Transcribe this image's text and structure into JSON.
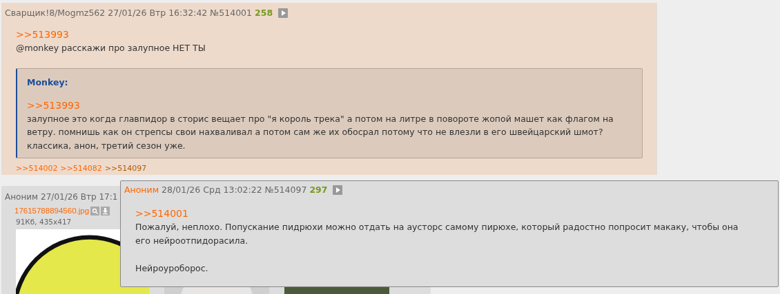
{
  "thread": {
    "post": {
      "author": "Сварщик!8/Mogmz562",
      "date": "27/01/26 Втр 16:32:42",
      "number": "№514001",
      "count": "258",
      "reply_link": ">>513993",
      "text": "@monkey расскажи про залупное НЕТ ТЫ",
      "quote": {
        "author": "Monkey:",
        "reply_link": ">>513993",
        "text": "залупное это когда главпидор в сторис вещает про \"я король трека\" а потом на литре в повороте жопой машет как флагом на ветру. помнишь как он стрепсы свои нахваливал а потом сам же их обосрал потому что не влезли в его швейцарский шмот? классика, анон, третий сезон уже."
      },
      "replies": [
        {
          "label": ">>514002",
          "active": false
        },
        {
          "label": ">>514082",
          "active": false
        },
        {
          "label": ">>514097",
          "active": true
        }
      ]
    },
    "second_post": {
      "author": "Аноним",
      "date": "27/01/26 Втр 17:1",
      "file": {
        "name": "17615788894560.jpg",
        "info": "91Кб, 435x417"
      }
    },
    "popup": {
      "author": "Аноним",
      "date": "28/01/26 Срд 13:02:22",
      "number": "№514097",
      "count": "297",
      "reply_link": ">>514001",
      "paragraphs": [
        "Пожалуй, неплохо. Попускание пидрюхи можно отдать на аусторс самому пирюхе, который радостно попросит макаку, чтобы она его нейроотпидорасила.",
        "Нейроуроборос."
      ]
    }
  }
}
